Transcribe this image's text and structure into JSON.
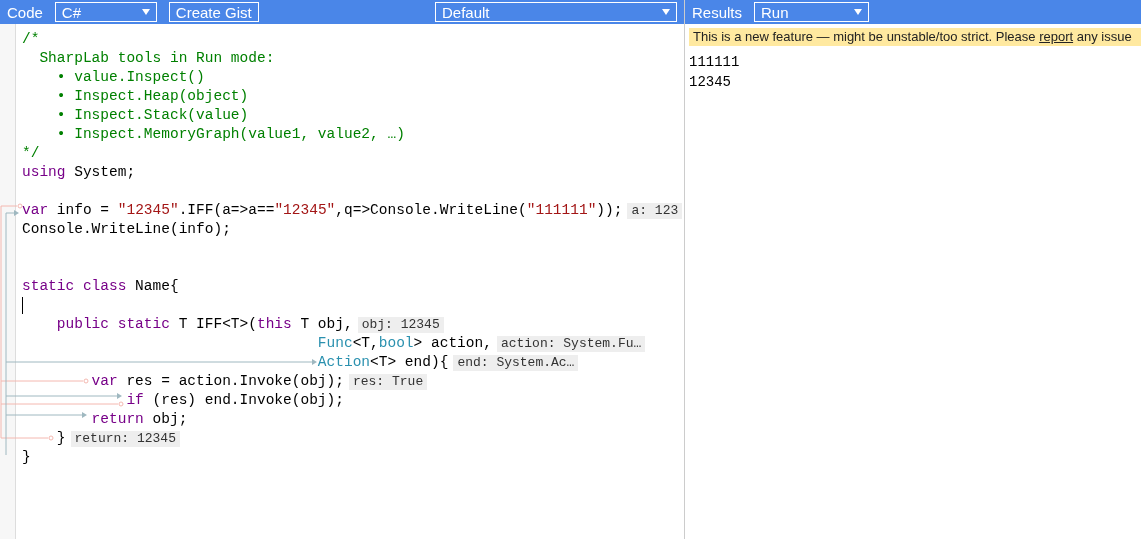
{
  "code_toolbar": {
    "label": "Code",
    "language": "C#",
    "gist_button": "Create Gist",
    "mode": "Default"
  },
  "results_toolbar": {
    "label": "Results",
    "mode": "Run"
  },
  "code_lines": [
    {
      "cursor": false,
      "tokens": [
        {
          "kind": "comment",
          "text": "/*"
        }
      ]
    },
    {
      "cursor": false,
      "tokens": [
        {
          "kind": "comment",
          "text": "  SharpLab tools in Run mode:"
        }
      ]
    },
    {
      "cursor": false,
      "tokens": [
        {
          "kind": "comment",
          "text": "    • value.Inspect()"
        }
      ]
    },
    {
      "cursor": false,
      "tokens": [
        {
          "kind": "comment",
          "text": "    • Inspect.Heap(object)"
        }
      ]
    },
    {
      "cursor": false,
      "tokens": [
        {
          "kind": "comment",
          "text": "    • Inspect.Stack(value)"
        }
      ]
    },
    {
      "cursor": false,
      "tokens": [
        {
          "kind": "comment",
          "text": "    • Inspect.MemoryGraph(value1, value2, …)"
        }
      ]
    },
    {
      "cursor": false,
      "tokens": [
        {
          "kind": "comment",
          "text": "*/"
        }
      ]
    },
    {
      "cursor": false,
      "tokens": [
        {
          "kind": "keyword",
          "text": "using"
        },
        {
          "kind": "plain",
          "text": " System;"
        }
      ]
    },
    {
      "cursor": false
    },
    {
      "cursor": false,
      "tokens": [
        {
          "kind": "keyword",
          "text": "var"
        },
        {
          "kind": "plain",
          "text": " info = "
        },
        {
          "kind": "string",
          "text": "\"12345\""
        },
        {
          "kind": "plain",
          "text": ".IFF(a=>a=="
        },
        {
          "kind": "string",
          "text": "\"12345\""
        },
        {
          "kind": "plain",
          "text": ",q=>Console.WriteLine("
        },
        {
          "kind": "string",
          "text": "\"111111\""
        },
        {
          "kind": "plain",
          "text": "));"
        }
      ],
      "annotation": "a: 123"
    },
    {
      "cursor": false,
      "tokens": [
        {
          "kind": "plain",
          "text": "Console.WriteLine(info);"
        }
      ]
    },
    {
      "cursor": false
    },
    {
      "cursor": false
    },
    {
      "cursor": false,
      "tokens": [
        {
          "kind": "keyword",
          "text": "static class"
        },
        {
          "kind": "plain",
          "text": " Name{"
        }
      ]
    },
    {
      "cursor": true
    },
    {
      "cursor": false,
      "tokens": [
        {
          "kind": "keyword",
          "text": "    public static"
        },
        {
          "kind": "plain",
          "text": " T IFF<T>("
        },
        {
          "kind": "keyword",
          "text": "this"
        },
        {
          "kind": "plain",
          "text": " T obj,"
        }
      ],
      "annotation": "obj: 12345"
    },
    {
      "cursor": false,
      "tokens": [
        {
          "kind": "type",
          "text": "                                  Func"
        },
        {
          "kind": "plain",
          "text": "<T,"
        },
        {
          "kind": "type",
          "text": "bool"
        },
        {
          "kind": "plain",
          "text": "> action,"
        }
      ],
      "annotation": "action: System.Fu…"
    },
    {
      "cursor": false,
      "tokens": [
        {
          "kind": "type",
          "text": "                                  Action"
        },
        {
          "kind": "plain",
          "text": "<T> end){"
        }
      ],
      "annotation": "end: System.Ac…"
    },
    {
      "cursor": false,
      "tokens": [
        {
          "kind": "keyword",
          "text": "        var"
        },
        {
          "kind": "plain",
          "text": " res = action.Invoke(obj);"
        }
      ],
      "annotation": "res: True"
    },
    {
      "cursor": false,
      "tokens": [
        {
          "kind": "keyword",
          "text": "            if"
        },
        {
          "kind": "plain",
          "text": " (res) end.Invoke(obj);"
        }
      ]
    },
    {
      "cursor": false,
      "tokens": [
        {
          "kind": "keyword",
          "text": "        return"
        },
        {
          "kind": "plain",
          "text": " obj;"
        }
      ]
    },
    {
      "cursor": false,
      "tokens": [
        {
          "kind": "plain",
          "text": "    }"
        }
      ],
      "annotation": "return: 12345"
    },
    {
      "cursor": false,
      "tokens": [
        {
          "kind": "plain",
          "text": "}"
        }
      ]
    }
  ],
  "notice": {
    "text_before": "This is a new feature — might be unstable/too strict. Please ",
    "link": "report",
    "text_after": " any issue"
  },
  "output": [
    "111111",
    "12345"
  ]
}
